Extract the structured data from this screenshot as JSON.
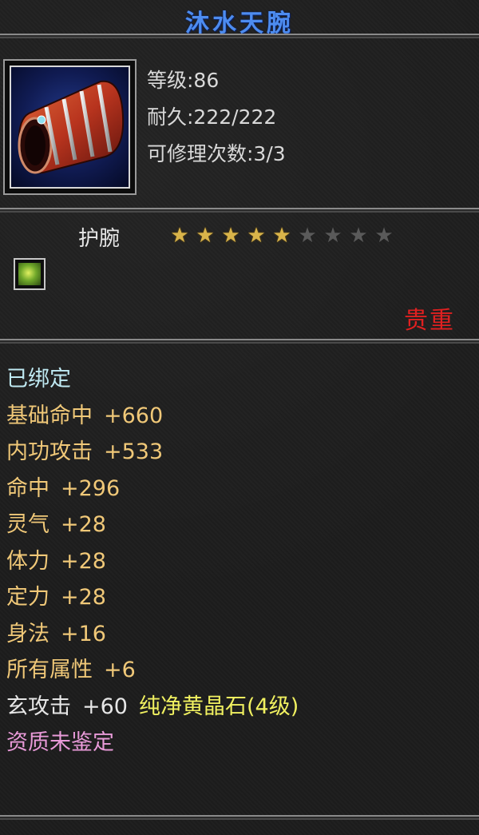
{
  "item": {
    "name": "沐水天腕",
    "level_text": "等级:86",
    "durability_text": "耐久:222/222",
    "repair_text": "可修理次数:3/3",
    "type": "护腕",
    "stars_total": 9,
    "stars_filled": 5,
    "rarity": "贵重"
  },
  "attributes": {
    "bound": "已绑定",
    "lines": [
      {
        "name": "基础命中",
        "value": "+660"
      },
      {
        "name": "内功攻击",
        "value": "+533"
      },
      {
        "name": "命中",
        "value": "+296"
      },
      {
        "name": "灵气",
        "value": "+28"
      },
      {
        "name": "体力",
        "value": "+28"
      },
      {
        "name": "定力",
        "value": "+28"
      },
      {
        "name": "身法",
        "value": "+16"
      },
      {
        "name": "所有属性",
        "value": "+6"
      }
    ],
    "gem_line": {
      "name": "玄攻击",
      "value": "+60",
      "gem": "纯净黄晶石(4级)"
    },
    "aptitude": "资质未鉴定"
  },
  "colors": {
    "title": "#4d8cf0",
    "rarity": "#e02020",
    "bound": "#bfe9f2",
    "attribute": "#f0c878",
    "gem": "#f0f060",
    "aptitude": "#e89ad8"
  },
  "icons": {
    "item": "bracer-icon",
    "gem": "yellow-gem-icon",
    "star_on": "star-filled-icon",
    "star_off": "star-empty-icon"
  }
}
